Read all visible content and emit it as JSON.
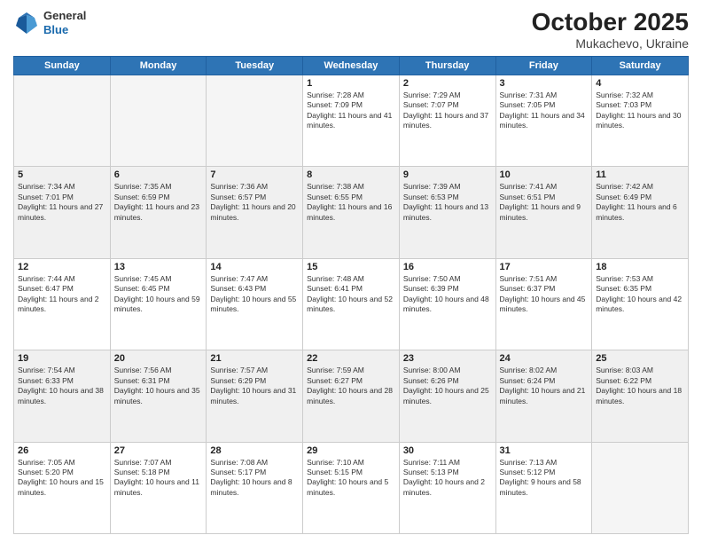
{
  "header": {
    "logo": {
      "line1": "General",
      "line2": "Blue"
    },
    "title": "October 2025",
    "subtitle": "Mukachevo, Ukraine"
  },
  "days_of_week": [
    "Sunday",
    "Monday",
    "Tuesday",
    "Wednesday",
    "Thursday",
    "Friday",
    "Saturday"
  ],
  "weeks": [
    {
      "shaded": false,
      "days": [
        {
          "num": "",
          "empty": true
        },
        {
          "num": "",
          "empty": true
        },
        {
          "num": "",
          "empty": true
        },
        {
          "num": "1",
          "sunrise": "Sunrise: 7:28 AM",
          "sunset": "Sunset: 7:09 PM",
          "daylight": "Daylight: 11 hours and 41 minutes."
        },
        {
          "num": "2",
          "sunrise": "Sunrise: 7:29 AM",
          "sunset": "Sunset: 7:07 PM",
          "daylight": "Daylight: 11 hours and 37 minutes."
        },
        {
          "num": "3",
          "sunrise": "Sunrise: 7:31 AM",
          "sunset": "Sunset: 7:05 PM",
          "daylight": "Daylight: 11 hours and 34 minutes."
        },
        {
          "num": "4",
          "sunrise": "Sunrise: 7:32 AM",
          "sunset": "Sunset: 7:03 PM",
          "daylight": "Daylight: 11 hours and 30 minutes."
        }
      ]
    },
    {
      "shaded": true,
      "days": [
        {
          "num": "5",
          "sunrise": "Sunrise: 7:34 AM",
          "sunset": "Sunset: 7:01 PM",
          "daylight": "Daylight: 11 hours and 27 minutes."
        },
        {
          "num": "6",
          "sunrise": "Sunrise: 7:35 AM",
          "sunset": "Sunset: 6:59 PM",
          "daylight": "Daylight: 11 hours and 23 minutes."
        },
        {
          "num": "7",
          "sunrise": "Sunrise: 7:36 AM",
          "sunset": "Sunset: 6:57 PM",
          "daylight": "Daylight: 11 hours and 20 minutes."
        },
        {
          "num": "8",
          "sunrise": "Sunrise: 7:38 AM",
          "sunset": "Sunset: 6:55 PM",
          "daylight": "Daylight: 11 hours and 16 minutes."
        },
        {
          "num": "9",
          "sunrise": "Sunrise: 7:39 AM",
          "sunset": "Sunset: 6:53 PM",
          "daylight": "Daylight: 11 hours and 13 minutes."
        },
        {
          "num": "10",
          "sunrise": "Sunrise: 7:41 AM",
          "sunset": "Sunset: 6:51 PM",
          "daylight": "Daylight: 11 hours and 9 minutes."
        },
        {
          "num": "11",
          "sunrise": "Sunrise: 7:42 AM",
          "sunset": "Sunset: 6:49 PM",
          "daylight": "Daylight: 11 hours and 6 minutes."
        }
      ]
    },
    {
      "shaded": false,
      "days": [
        {
          "num": "12",
          "sunrise": "Sunrise: 7:44 AM",
          "sunset": "Sunset: 6:47 PM",
          "daylight": "Daylight: 11 hours and 2 minutes."
        },
        {
          "num": "13",
          "sunrise": "Sunrise: 7:45 AM",
          "sunset": "Sunset: 6:45 PM",
          "daylight": "Daylight: 10 hours and 59 minutes."
        },
        {
          "num": "14",
          "sunrise": "Sunrise: 7:47 AM",
          "sunset": "Sunset: 6:43 PM",
          "daylight": "Daylight: 10 hours and 55 minutes."
        },
        {
          "num": "15",
          "sunrise": "Sunrise: 7:48 AM",
          "sunset": "Sunset: 6:41 PM",
          "daylight": "Daylight: 10 hours and 52 minutes."
        },
        {
          "num": "16",
          "sunrise": "Sunrise: 7:50 AM",
          "sunset": "Sunset: 6:39 PM",
          "daylight": "Daylight: 10 hours and 48 minutes."
        },
        {
          "num": "17",
          "sunrise": "Sunrise: 7:51 AM",
          "sunset": "Sunset: 6:37 PM",
          "daylight": "Daylight: 10 hours and 45 minutes."
        },
        {
          "num": "18",
          "sunrise": "Sunrise: 7:53 AM",
          "sunset": "Sunset: 6:35 PM",
          "daylight": "Daylight: 10 hours and 42 minutes."
        }
      ]
    },
    {
      "shaded": true,
      "days": [
        {
          "num": "19",
          "sunrise": "Sunrise: 7:54 AM",
          "sunset": "Sunset: 6:33 PM",
          "daylight": "Daylight: 10 hours and 38 minutes."
        },
        {
          "num": "20",
          "sunrise": "Sunrise: 7:56 AM",
          "sunset": "Sunset: 6:31 PM",
          "daylight": "Daylight: 10 hours and 35 minutes."
        },
        {
          "num": "21",
          "sunrise": "Sunrise: 7:57 AM",
          "sunset": "Sunset: 6:29 PM",
          "daylight": "Daylight: 10 hours and 31 minutes."
        },
        {
          "num": "22",
          "sunrise": "Sunrise: 7:59 AM",
          "sunset": "Sunset: 6:27 PM",
          "daylight": "Daylight: 10 hours and 28 minutes."
        },
        {
          "num": "23",
          "sunrise": "Sunrise: 8:00 AM",
          "sunset": "Sunset: 6:26 PM",
          "daylight": "Daylight: 10 hours and 25 minutes."
        },
        {
          "num": "24",
          "sunrise": "Sunrise: 8:02 AM",
          "sunset": "Sunset: 6:24 PM",
          "daylight": "Daylight: 10 hours and 21 minutes."
        },
        {
          "num": "25",
          "sunrise": "Sunrise: 8:03 AM",
          "sunset": "Sunset: 6:22 PM",
          "daylight": "Daylight: 10 hours and 18 minutes."
        }
      ]
    },
    {
      "shaded": false,
      "days": [
        {
          "num": "26",
          "sunrise": "Sunrise: 7:05 AM",
          "sunset": "Sunset: 5:20 PM",
          "daylight": "Daylight: 10 hours and 15 minutes."
        },
        {
          "num": "27",
          "sunrise": "Sunrise: 7:07 AM",
          "sunset": "Sunset: 5:18 PM",
          "daylight": "Daylight: 10 hours and 11 minutes."
        },
        {
          "num": "28",
          "sunrise": "Sunrise: 7:08 AM",
          "sunset": "Sunset: 5:17 PM",
          "daylight": "Daylight: 10 hours and 8 minutes."
        },
        {
          "num": "29",
          "sunrise": "Sunrise: 7:10 AM",
          "sunset": "Sunset: 5:15 PM",
          "daylight": "Daylight: 10 hours and 5 minutes."
        },
        {
          "num": "30",
          "sunrise": "Sunrise: 7:11 AM",
          "sunset": "Sunset: 5:13 PM",
          "daylight": "Daylight: 10 hours and 2 minutes."
        },
        {
          "num": "31",
          "sunrise": "Sunrise: 7:13 AM",
          "sunset": "Sunset: 5:12 PM",
          "daylight": "Daylight: 9 hours and 58 minutes."
        },
        {
          "num": "",
          "empty": true
        }
      ]
    }
  ]
}
